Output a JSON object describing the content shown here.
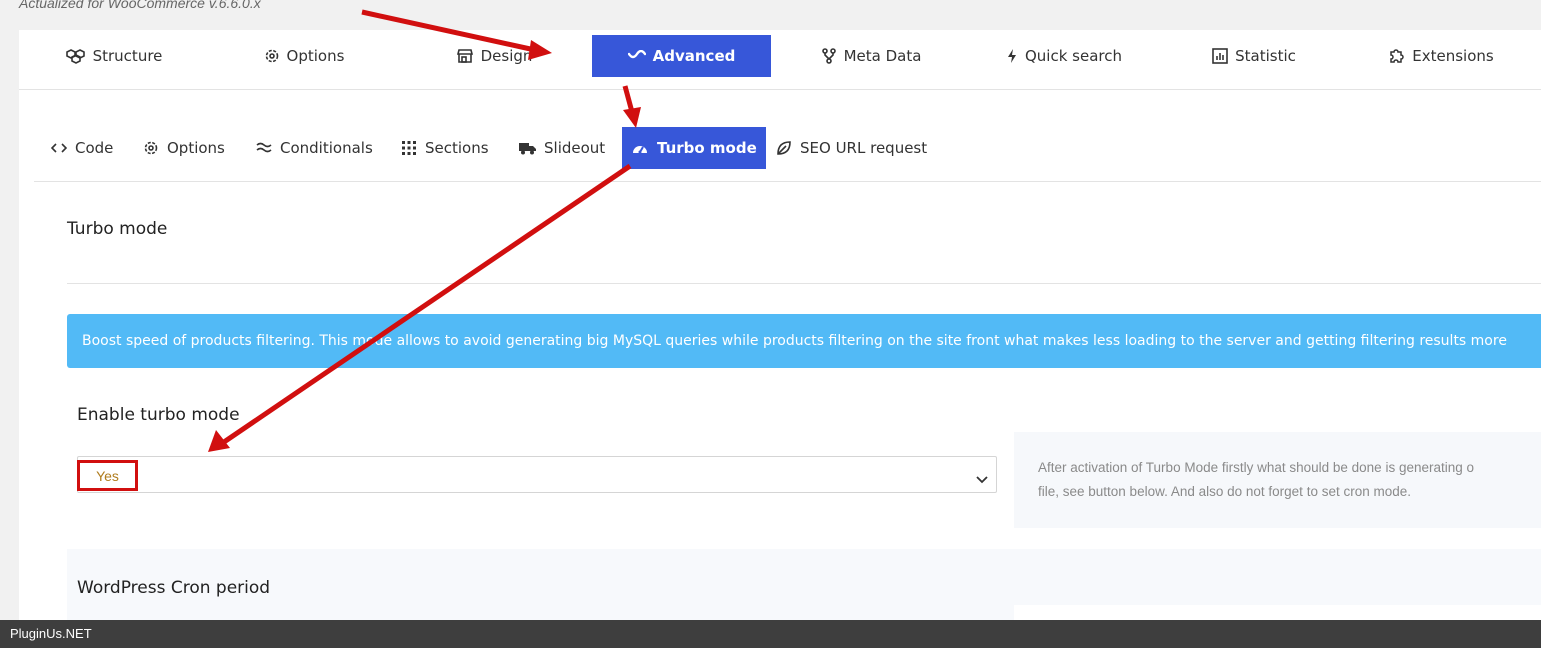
{
  "caption": "Actualized for WooCommerce v.6.6.0.x",
  "main_tabs": [
    {
      "label": "Structure",
      "icon": "cubes-icon"
    },
    {
      "label": "Options",
      "icon": "gear-icon"
    },
    {
      "label": "Design",
      "icon": "store-icon"
    },
    {
      "label": "Advanced",
      "icon": "wave-icon",
      "active": true
    },
    {
      "label": "Meta Data",
      "icon": "nodes-icon"
    },
    {
      "label": "Quick search",
      "icon": "bolt-icon"
    },
    {
      "label": "Statistic",
      "icon": "bar-chart-icon"
    },
    {
      "label": "Extensions",
      "icon": "puzzle-icon"
    }
  ],
  "sub_tabs": [
    {
      "label": "Code",
      "icon": "code-icon"
    },
    {
      "label": "Options",
      "icon": "gear-icon"
    },
    {
      "label": "Conditionals",
      "icon": "approx-icon"
    },
    {
      "label": "Sections",
      "icon": "grid-icon"
    },
    {
      "label": "Slideout",
      "icon": "truck-icon"
    },
    {
      "label": "Turbo mode",
      "icon": "speedometer-icon",
      "active": true
    },
    {
      "label": "SEO URL request",
      "icon": "leaf-icon"
    }
  ],
  "section": {
    "title": "Turbo mode",
    "info": "Boost speed of products filtering. This mode allows to avoid generating big MySQL queries while products filtering on the site front what makes less loading to the server and getting filtering results more"
  },
  "turbo_field": {
    "label": "Enable turbo mode",
    "value": "Yes",
    "hint_line1": "After activation of Turbo Mode firstly what should be done is generating o",
    "hint_line2": "file, see button below. And also do not forget to set cron mode."
  },
  "cron_field": {
    "label": "WordPress Cron period"
  },
  "footer": "PluginUs.NET",
  "colors": {
    "accent": "#3757d9",
    "info": "#52baf6",
    "annotation": "#d10f0f",
    "value": "#b07c1d"
  }
}
